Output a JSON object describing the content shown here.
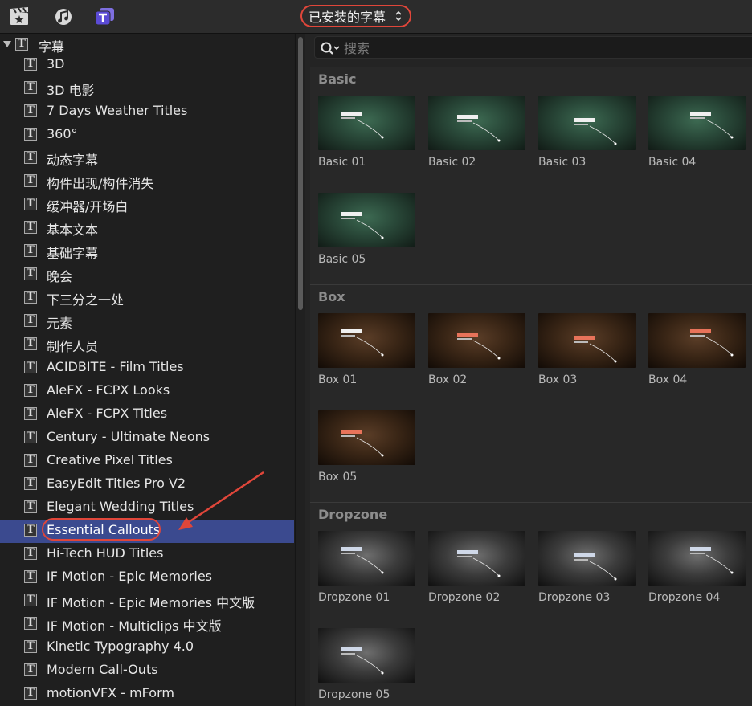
{
  "toolbar": {
    "dropdown_label": "已安装的字幕"
  },
  "search": {
    "placeholder": "搜索"
  },
  "sidebar": {
    "root_label": "字幕",
    "items": [
      "3D",
      "3D 电影",
      "7 Days Weather Titles",
      "360°",
      "动态字幕",
      "构件出现/构件消失",
      "缓冲器/开场白",
      "基本文本",
      "基础字幕",
      "晚会",
      "下三分之一处",
      "元素",
      "制作人员",
      "ACIDBITE - Film Titles",
      "AleFX - FCPX Looks",
      "AleFX - FCPX Titles",
      "Century - Ultimate Neons",
      "Creative Pixel Titles",
      "EasyEdit Titles Pro V2",
      "Elegant Wedding Titles",
      "Essential Callouts",
      "Hi-Tech HUD Titles",
      "IF Motion - Epic Memories",
      "IF Motion - Epic Memories 中文版",
      "IF Motion - Multiclips 中文版",
      "Kinetic Typography 4.0",
      "Modern Call-Outs",
      "motionVFX - mForm"
    ],
    "selected_item": "Essential Callouts"
  },
  "sections": [
    {
      "title": "Basic",
      "items": [
        "Basic 01",
        "Basic 02",
        "Basic 03",
        "Basic 04",
        "Basic 05"
      ]
    },
    {
      "title": "Box",
      "items": [
        "Box 01",
        "Box 02",
        "Box 03",
        "Box 04",
        "Box 05"
      ]
    },
    {
      "title": "Dropzone",
      "items": [
        "Dropzone 01",
        "Dropzone 02",
        "Dropzone 03",
        "Dropzone 04",
        "Dropzone 05"
      ]
    }
  ],
  "colors": {
    "accent_outline": "#e0463a",
    "selection": "#3b4a8f"
  }
}
